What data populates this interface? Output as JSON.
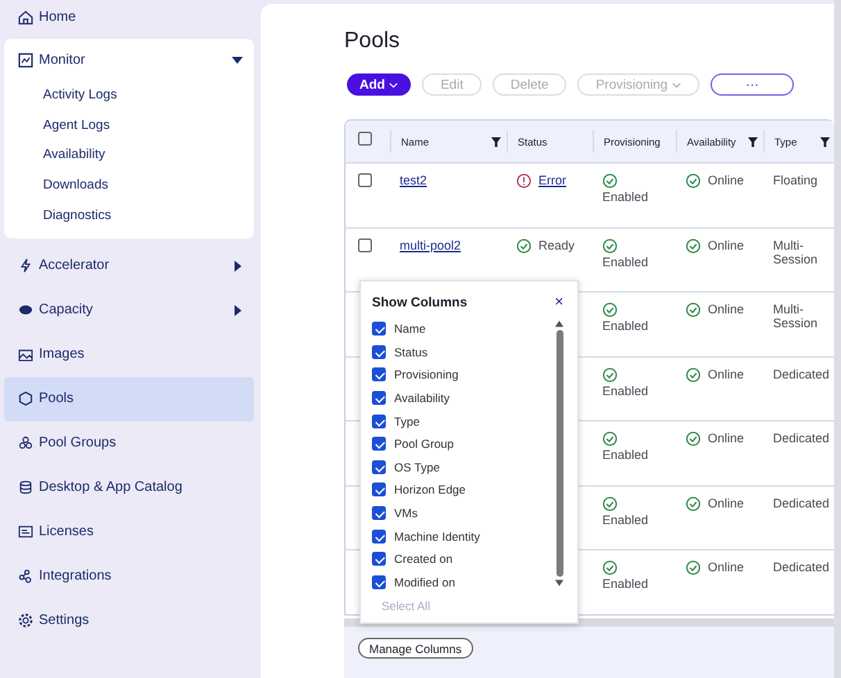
{
  "sidebar": {
    "items": [
      {
        "label": "Home",
        "selected": false
      },
      {
        "label": "Monitor",
        "selected": false,
        "expanded": true,
        "children": [
          {
            "label": "Activity Logs"
          },
          {
            "label": "Agent Logs"
          },
          {
            "label": "Availability"
          },
          {
            "label": "Downloads"
          },
          {
            "label": "Diagnostics"
          }
        ]
      },
      {
        "label": "Accelerator",
        "selected": false,
        "expanded": false
      },
      {
        "label": "Capacity",
        "selected": false,
        "expanded": false
      },
      {
        "label": "Images",
        "selected": false
      },
      {
        "label": "Pools",
        "selected": true
      },
      {
        "label": "Pool Groups",
        "selected": false
      },
      {
        "label": "Desktop & App Catalog",
        "selected": false
      },
      {
        "label": "Licenses",
        "selected": false
      },
      {
        "label": "Integrations",
        "selected": false
      },
      {
        "label": "Settings",
        "selected": false
      }
    ]
  },
  "page_title": "Pools",
  "toolbar": [
    {
      "kind": "primary",
      "label": "Add",
      "caret": true,
      "disabled": false
    },
    {
      "kind": "plain",
      "label": "Edit",
      "caret": false,
      "disabled": true
    },
    {
      "kind": "plain",
      "label": "Delete",
      "caret": false,
      "disabled": true
    },
    {
      "kind": "plain",
      "label": "Provisioning",
      "caret": true,
      "disabled": true
    },
    {
      "kind": "more",
      "label": "···",
      "caret": false,
      "disabled": false
    }
  ],
  "table": {
    "columns": [
      {
        "label": "Name",
        "filter": true
      },
      {
        "label": "Status",
        "filter": false
      },
      {
        "label": "Provisioning",
        "filter": false
      },
      {
        "label": "Availability",
        "filter": true
      },
      {
        "label": "Type",
        "filter": true
      }
    ],
    "header_checked": false,
    "rows": [
      {
        "checked": false,
        "name": "test2",
        "status": {
          "kind": "error",
          "label": "Error"
        },
        "provisioning": "Enabled",
        "availability": "Online",
        "type": "Floating"
      },
      {
        "checked": false,
        "name": "multi-pool2",
        "status": {
          "kind": "ready",
          "label": "Ready"
        },
        "provisioning": "Enabled",
        "availability": "Online",
        "type": "Multi-Session"
      },
      {
        "provisioning": "Enabled",
        "availability": "Online",
        "type": "Multi-Session"
      },
      {
        "provisioning": "Enabled",
        "availability": "Online",
        "type": "Dedicated"
      },
      {
        "provisioning": "Enabled",
        "availability": "Online",
        "type": "Dedicated"
      },
      {
        "provisioning": "Enabled",
        "availability": "Online",
        "type": "Dedicated"
      },
      {
        "provisioning": "Enabled",
        "availability": "Online",
        "type": "Dedicated"
      }
    ]
  },
  "column_picker": {
    "title": "Show Columns",
    "close": "×",
    "items": [
      {
        "label": "Name",
        "checked": true
      },
      {
        "label": "Status",
        "checked": true
      },
      {
        "label": "Provisioning",
        "checked": true
      },
      {
        "label": "Availability",
        "checked": true
      },
      {
        "label": "Type",
        "checked": true
      },
      {
        "label": "Pool Group",
        "checked": true
      },
      {
        "label": "OS Type",
        "checked": true
      },
      {
        "label": "Horizon Edge",
        "checked": true
      },
      {
        "label": "VMs",
        "checked": true
      },
      {
        "label": "Machine Identity",
        "checked": true
      },
      {
        "label": "Created on",
        "checked": true
      },
      {
        "label": "Modified on",
        "checked": true
      }
    ],
    "select_all": {
      "label": "Select All",
      "disabled": true
    }
  },
  "footer": {
    "button": "Manage Columns"
  }
}
